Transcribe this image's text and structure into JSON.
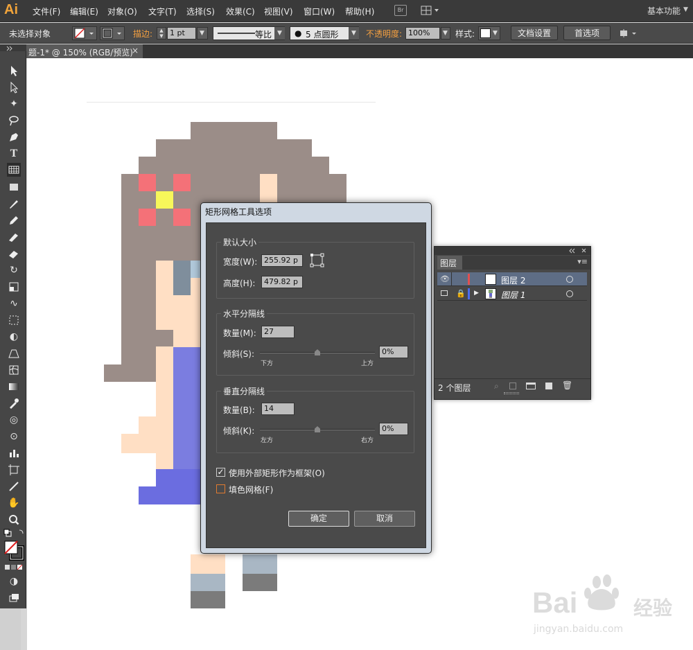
{
  "app": {
    "logo": "Ai"
  },
  "menubar": {
    "items": [
      "文件(F)",
      "编辑(E)",
      "对象(O)",
      "文字(T)",
      "选择(S)",
      "效果(C)",
      "视图(V)",
      "窗口(W)",
      "帮助(H)"
    ],
    "bridge": "Br",
    "workspace": "基本功能"
  },
  "control_bar": {
    "selection": "未选择对象",
    "stroke_label": "描边:",
    "stroke_weight": "1 pt",
    "stroke_profile": "等比",
    "brush": "5 点圆形",
    "opacity_label": "不透明度:",
    "opacity_value": "100%",
    "style_label": "样式:",
    "doc_setup": "文档设置",
    "preferences": "首选项"
  },
  "document_tab": {
    "title": "题-1* @ 150% (RGB/预览)",
    "close": "×"
  },
  "dialog": {
    "title": "矩形网格工具选项",
    "default_size": {
      "title": "默认大小",
      "width_label": "宽度(W):",
      "width_value": "255.92 p",
      "height_label": "高度(H):",
      "height_value": "479.82 p"
    },
    "horizontal": {
      "title": "水平分隔线",
      "count_label": "数量(M):",
      "count_value": "27",
      "skew_label": "倾斜(S):",
      "skew_value": "0%",
      "min_label": "下方",
      "max_label": "上方"
    },
    "vertical": {
      "title": "垂直分隔线",
      "count_label": "数量(B):",
      "count_value": "14",
      "skew_label": "倾斜(K):",
      "skew_value": "0%",
      "min_label": "左方",
      "max_label": "右方"
    },
    "use_outer_rect": {
      "label": "使用外部矩形作为框架(O)",
      "checked": true
    },
    "fill_grid": {
      "label": "填色网格(F)",
      "checked": false
    },
    "ok": "确定",
    "cancel": "取消"
  },
  "layers_panel": {
    "tab": "图层",
    "layers": [
      {
        "name": "图层 2",
        "color": "#e05050",
        "selected": true,
        "locked": false
      },
      {
        "name": "图层 1",
        "color": "#4a6cf0",
        "selected": false,
        "locked": true
      }
    ],
    "count": "2 个图层"
  },
  "watermark": {
    "brand": "Bai",
    "brand2": "经验",
    "url": "jingyan.baidu.com"
  }
}
